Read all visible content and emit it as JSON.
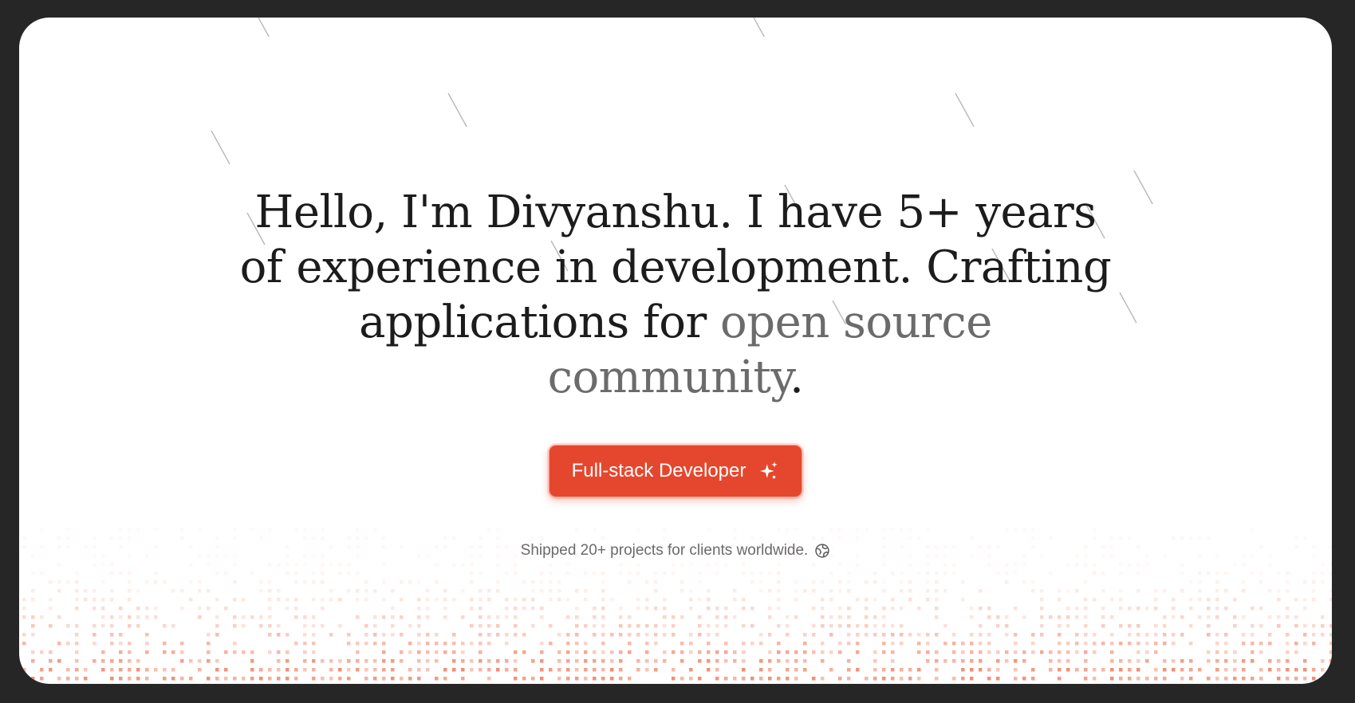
{
  "hero": {
    "headline_part1": "Hello, I'm Divyanshu. I have 5+ years of experience in development. Crafting applications for ",
    "headline_highlight": "open source community",
    "headline_end": "."
  },
  "cta": {
    "label": "Full-stack Developer",
    "icon": "sparkles-icon"
  },
  "subline": {
    "text": "Shipped 20+ projects for clients worldwide.",
    "icon": "globe-icon"
  },
  "colors": {
    "background": "#262626",
    "card": "#ffffff",
    "accent": "#e5472e",
    "headline": "#1c1c1c",
    "muted": "#6b6b6b"
  }
}
